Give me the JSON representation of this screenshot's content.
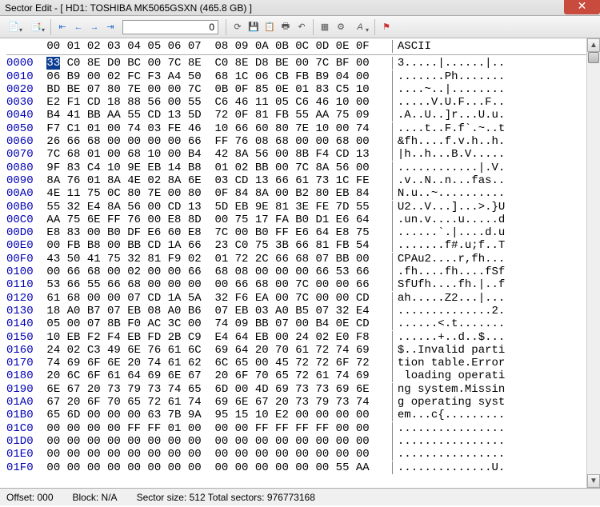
{
  "title": "Sector Edit - [ HD1: TOSHIBA MK5065GSXN (465.8 GB) ]",
  "toolbar": {
    "sector_input": "0"
  },
  "header": {
    "cols": "00 01 02 03 04 05 06 07  08 09 0A 0B 0C 0D 0E 0F",
    "ascii": "ASCII"
  },
  "rows": [
    {
      "off": "0000",
      "b0": "33",
      "rest": " C0 8E D0 BC 00 7C 8E  C0 8E D8 BE 00 7C BF 00",
      "asc": "3.....|......|.."
    },
    {
      "off": "0010",
      "hex": "06 B9 00 02 FC F3 A4 50  68 1C 06 CB FB B9 04 00",
      "asc": ".......Ph......."
    },
    {
      "off": "0020",
      "hex": "BD BE 07 80 7E 00 00 7C  0B 0F 85 0E 01 83 C5 10",
      "asc": "....~..|........"
    },
    {
      "off": "0030",
      "hex": "E2 F1 CD 18 88 56 00 55  C6 46 11 05 C6 46 10 00",
      "asc": ".....V.U.F...F.."
    },
    {
      "off": "0040",
      "hex": "B4 41 BB AA 55 CD 13 5D  72 0F 81 FB 55 AA 75 09",
      "asc": ".A..U..]r...U.u."
    },
    {
      "off": "0050",
      "hex": "F7 C1 01 00 74 03 FE 46  10 66 60 80 7E 10 00 74",
      "asc": "....t..F.f`.~..t"
    },
    {
      "off": "0060",
      "hex": "26 66 68 00 00 00 00 66  FF 76 08 68 00 00 68 00",
      "asc": "&fh....f.v.h..h."
    },
    {
      "off": "0070",
      "hex": "7C 68 01 00 68 10 00 B4  42 8A 56 00 8B F4 CD 13",
      "asc": "|h..h...B.V....."
    },
    {
      "off": "0080",
      "hex": "9F 83 C4 10 9E EB 14 B8  01 02 BB 00 7C 8A 56 00",
      "asc": "............|.V."
    },
    {
      "off": "0090",
      "hex": "8A 76 01 8A 4E 02 8A 6E  03 CD 13 66 61 73 1C FE",
      "asc": ".v..N..n...fas.."
    },
    {
      "off": "00A0",
      "hex": "4E 11 75 0C 80 7E 00 80  0F 84 8A 00 B2 80 EB 84",
      "asc": "N.u..~.........."
    },
    {
      "off": "00B0",
      "hex": "55 32 E4 8A 56 00 CD 13  5D EB 9E 81 3E FE 7D 55",
      "asc": "U2..V...]...>.}U"
    },
    {
      "off": "00C0",
      "hex": "AA 75 6E FF 76 00 E8 8D  00 75 17 FA B0 D1 E6 64",
      "asc": ".un.v....u.....d"
    },
    {
      "off": "00D0",
      "hex": "E8 83 00 B0 DF E6 60 E8  7C 00 B0 FF E6 64 E8 75",
      "asc": "......`.|....d.u"
    },
    {
      "off": "00E0",
      "hex": "00 FB B8 00 BB CD 1A 66  23 C0 75 3B 66 81 FB 54",
      "asc": ".......f#.u;f..T"
    },
    {
      "off": "00F0",
      "hex": "43 50 41 75 32 81 F9 02  01 72 2C 66 68 07 BB 00",
      "asc": "CPAu2....r,fh..."
    },
    {
      "off": "0100",
      "hex": "00 66 68 00 02 00 00 66  68 08 00 00 00 66 53 66",
      "asc": ".fh....fh....fSf"
    },
    {
      "off": "0110",
      "hex": "53 66 55 66 68 00 00 00  00 66 68 00 7C 00 00 66",
      "asc": "SfUfh....fh.|..f"
    },
    {
      "off": "0120",
      "hex": "61 68 00 00 07 CD 1A 5A  32 F6 EA 00 7C 00 00 CD",
      "asc": "ah.....Z2...|..."
    },
    {
      "off": "0130",
      "hex": "18 A0 B7 07 EB 08 A0 B6  07 EB 03 A0 B5 07 32 E4",
      "asc": "..............2."
    },
    {
      "off": "0140",
      "hex": "05 00 07 8B F0 AC 3C 00  74 09 BB 07 00 B4 0E CD",
      "asc": "......<.t......."
    },
    {
      "off": "0150",
      "hex": "10 EB F2 F4 EB FD 2B C9  E4 64 EB 00 24 02 E0 F8",
      "asc": "......+..d..$..."
    },
    {
      "off": "0160",
      "hex": "24 02 C3 49 6E 76 61 6C  69 64 20 70 61 72 74 69",
      "asc": "$..Invalid parti"
    },
    {
      "off": "0170",
      "hex": "74 69 6F 6E 20 74 61 62  6C 65 00 45 72 72 6F 72",
      "asc": "tion table.Error"
    },
    {
      "off": "0180",
      "hex": "20 6C 6F 61 64 69 6E 67  20 6F 70 65 72 61 74 69",
      "asc": " loading operati"
    },
    {
      "off": "0190",
      "hex": "6E 67 20 73 79 73 74 65  6D 00 4D 69 73 73 69 6E",
      "asc": "ng system.Missin"
    },
    {
      "off": "01A0",
      "hex": "67 20 6F 70 65 72 61 74  69 6E 67 20 73 79 73 74",
      "asc": "g operating syst"
    },
    {
      "off": "01B0",
      "hex": "65 6D 00 00 00 63 7B 9A  95 15 10 E2 00 00 00 00",
      "asc": "em...c{........."
    },
    {
      "off": "01C0",
      "hex": "00 00 00 00 FF FF 01 00  00 00 FF FF FF FF 00 00",
      "asc": "................"
    },
    {
      "off": "01D0",
      "hex": "00 00 00 00 00 00 00 00  00 00 00 00 00 00 00 00",
      "asc": "................"
    },
    {
      "off": "01E0",
      "hex": "00 00 00 00 00 00 00 00  00 00 00 00 00 00 00 00",
      "asc": "................"
    },
    {
      "off": "01F0",
      "hex": "00 00 00 00 00 00 00 00  00 00 00 00 00 00 55 AA",
      "asc": "..............U."
    }
  ],
  "status": {
    "offset_lbl": "Offset:",
    "offset_val": "000",
    "block_lbl": "Block:",
    "block_val": "N/A",
    "sectorsize_lbl": "Sector size:",
    "sectorsize_val": "512",
    "totalsectors_lbl": "Total sectors:",
    "totalsectors_val": "976773168"
  }
}
